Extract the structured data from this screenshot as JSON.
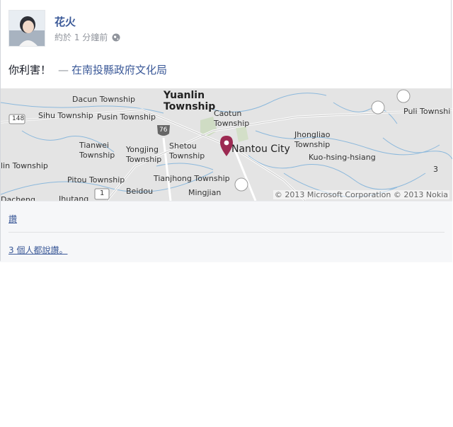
{
  "post": {
    "author": "花火",
    "timestamp": "約於 1 分鐘前",
    "privacy_icon": "globe-icon",
    "status_text": "你利害！",
    "separator": "—",
    "location_prefix": "在",
    "location": "南投縣政府文化局"
  },
  "map": {
    "labels": {
      "yuanlin": "Yuanlin\nTownship",
      "dacun": "Dacun Township",
      "caotun": "Caotun\nTownship",
      "puli": "Puli Townshi",
      "sihu": "Sihu Township",
      "pusin": "Pusin Township",
      "tianwei": "Tianwei\nTownship",
      "yongjing": "Yongjing\nTownship",
      "shetou": "Shetou\nTownship",
      "nantou": "Nantou City",
      "jhongliao": "Jhongliao\nTownship",
      "kuo": "Kuo-hsing-hsiang",
      "lin": "lin Township",
      "pitou": "Pitou Township",
      "tianjhong": "Tianjhong Township",
      "beidou": "Beidou",
      "mingjian": "Mingjian",
      "ihutang": "Ihutang",
      "dacheng": "Dacheng",
      "route148": "148",
      "route76": "76",
      "route1": "1",
      "route3": "3"
    },
    "copyright": "© 2013 Microsoft Corporation © 2013 Nokia"
  },
  "actions": {
    "like": "讚",
    "like_count": "3 個人都說讚。"
  }
}
